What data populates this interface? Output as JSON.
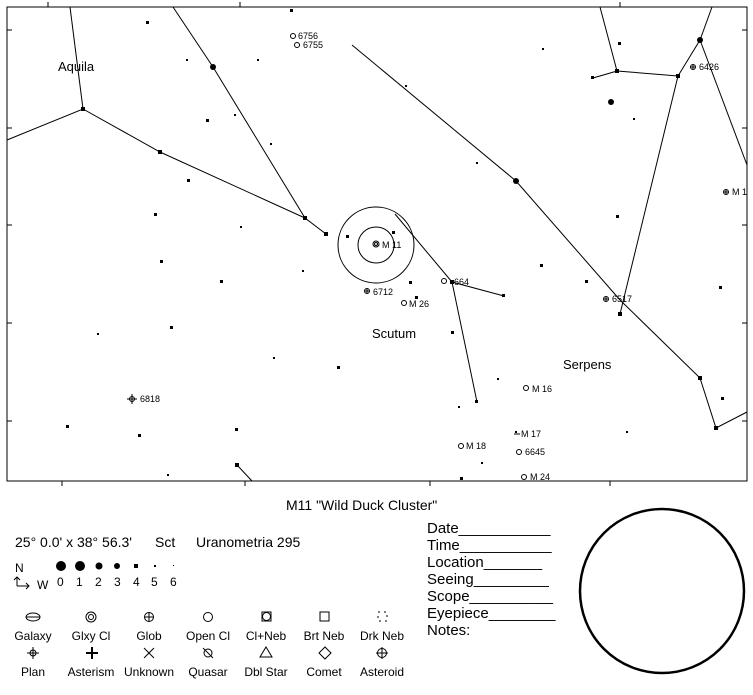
{
  "chart_title": "M11 \"Wild Duck Cluster\"",
  "field_size": "25° 0.0' x 38° 56.3'",
  "constellation_abbr": "Sct",
  "atlas_ref": "Uranometria 295",
  "compass": {
    "north": "N",
    "west": "W"
  },
  "magnitudes": [
    "0",
    "1",
    "2",
    "3",
    "4",
    "5",
    "6"
  ],
  "constellations": [
    "Aquila",
    "Scutum",
    "Serpens"
  ],
  "objects": [
    "M 11",
    "6712",
    "664",
    "M 26",
    "6756",
    "6755",
    "6426",
    "M 1",
    "6517",
    "6818",
    "M 16",
    "M 17",
    "M 18",
    "6645",
    "M 24"
  ],
  "legend": {
    "row1": [
      "Galaxy",
      "Glxy Cl",
      "Glob",
      "Open Cl",
      "Cl+Neb",
      "Brt Neb",
      "Drk Neb"
    ],
    "row2": [
      "Plan",
      "Asterism",
      "Unknown",
      "Quasar",
      "Dbl Star",
      "Comet",
      "Asteroid"
    ]
  },
  "form_fields": [
    "Date___________",
    "Time___________",
    "Location_______",
    "Seeing_________",
    "Scope__________",
    "Eyepiece________",
    "Notes:"
  ]
}
